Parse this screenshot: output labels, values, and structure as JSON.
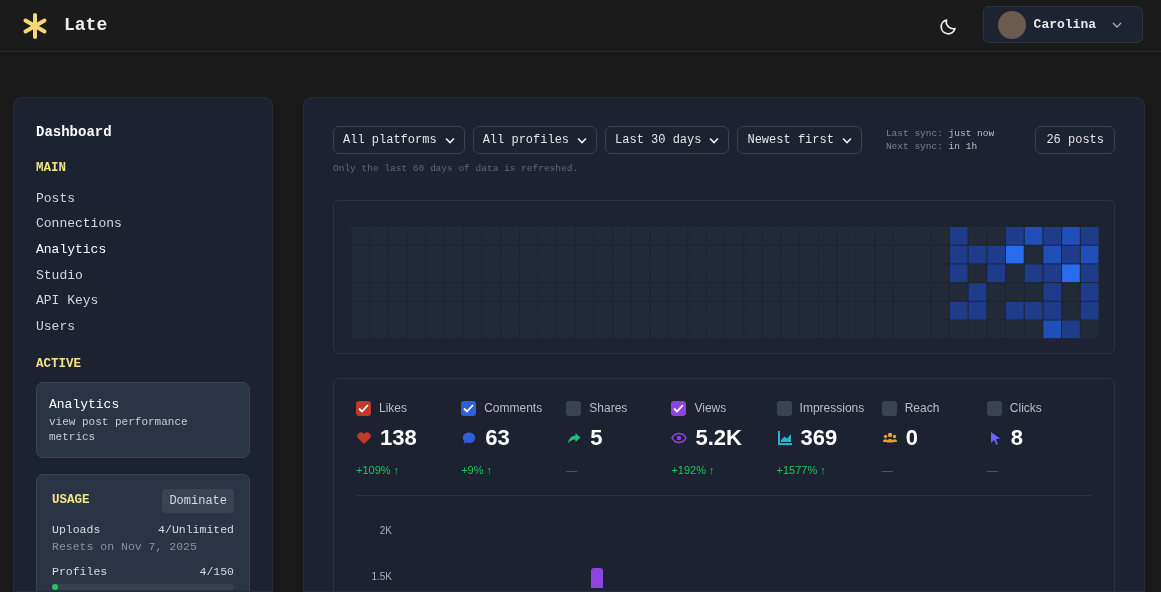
{
  "header": {
    "app_name": "Late",
    "user": {
      "name": "Carolina"
    }
  },
  "sidebar": {
    "title": "Dashboard",
    "sections": [
      {
        "heading": "MAIN",
        "items": [
          {
            "label": "Posts",
            "selected": false
          },
          {
            "label": "Connections",
            "selected": false
          },
          {
            "label": "Analytics",
            "selected": true
          },
          {
            "label": "Studio",
            "selected": false
          },
          {
            "label": "API Keys",
            "selected": false
          },
          {
            "label": "Users",
            "selected": false
          }
        ]
      }
    ],
    "active": {
      "heading": "ACTIVE",
      "title": "Analytics",
      "description": "view post performance metrics"
    },
    "usage": {
      "heading": "USAGE",
      "plan": "Dominate",
      "uploads_label": "Uploads",
      "uploads_value": "4/Unlimited",
      "reset_note": "Resets on Nov 7, 2025",
      "profiles": {
        "label": "Profiles",
        "value": "4/150",
        "level": 0.027
      }
    }
  },
  "filters": [
    {
      "label": "All platforms"
    },
    {
      "label": "All profiles"
    },
    {
      "label": "Last 30 days"
    },
    {
      "label": "Newest first"
    }
  ],
  "sync": {
    "last_label": "Last sync:",
    "last_value": "just now",
    "next_label": "Next sync:",
    "next_value": "in 1h"
  },
  "post_count": "26 posts",
  "refresh_note": "Only the last 60 days of data is refreshed.",
  "metrics": [
    {
      "kind": "likes",
      "label": "Likes",
      "checked": true,
      "color": "#c0392b",
      "value": "138",
      "change": "+109% ↑"
    },
    {
      "kind": "comments",
      "label": "Comments",
      "checked": true,
      "color": "#2d5fd8",
      "value": "63",
      "change": "+9% ↑"
    },
    {
      "kind": "shares",
      "label": "Shares",
      "checked": false,
      "color": "#1fbf7a",
      "value": "5",
      "change": "—"
    },
    {
      "kind": "views",
      "label": "Views",
      "checked": true,
      "color": "#8e44e0",
      "value": "5.2K",
      "change": "+192% ↑"
    },
    {
      "kind": "impressions",
      "label": "Impressions",
      "checked": false,
      "color": "#1fb6d0",
      "value": "369",
      "change": "+1577% ↑"
    },
    {
      "kind": "reach",
      "label": "Reach",
      "checked": false,
      "color": "#f0a020",
      "value": "0",
      "change": "—"
    },
    {
      "kind": "clicks",
      "label": "Clicks",
      "checked": false,
      "color": "#6c63ff",
      "value": "8",
      "change": "—"
    }
  ],
  "chart": {
    "y_axis_labels": [
      "2K",
      "1.5K"
    ]
  }
}
